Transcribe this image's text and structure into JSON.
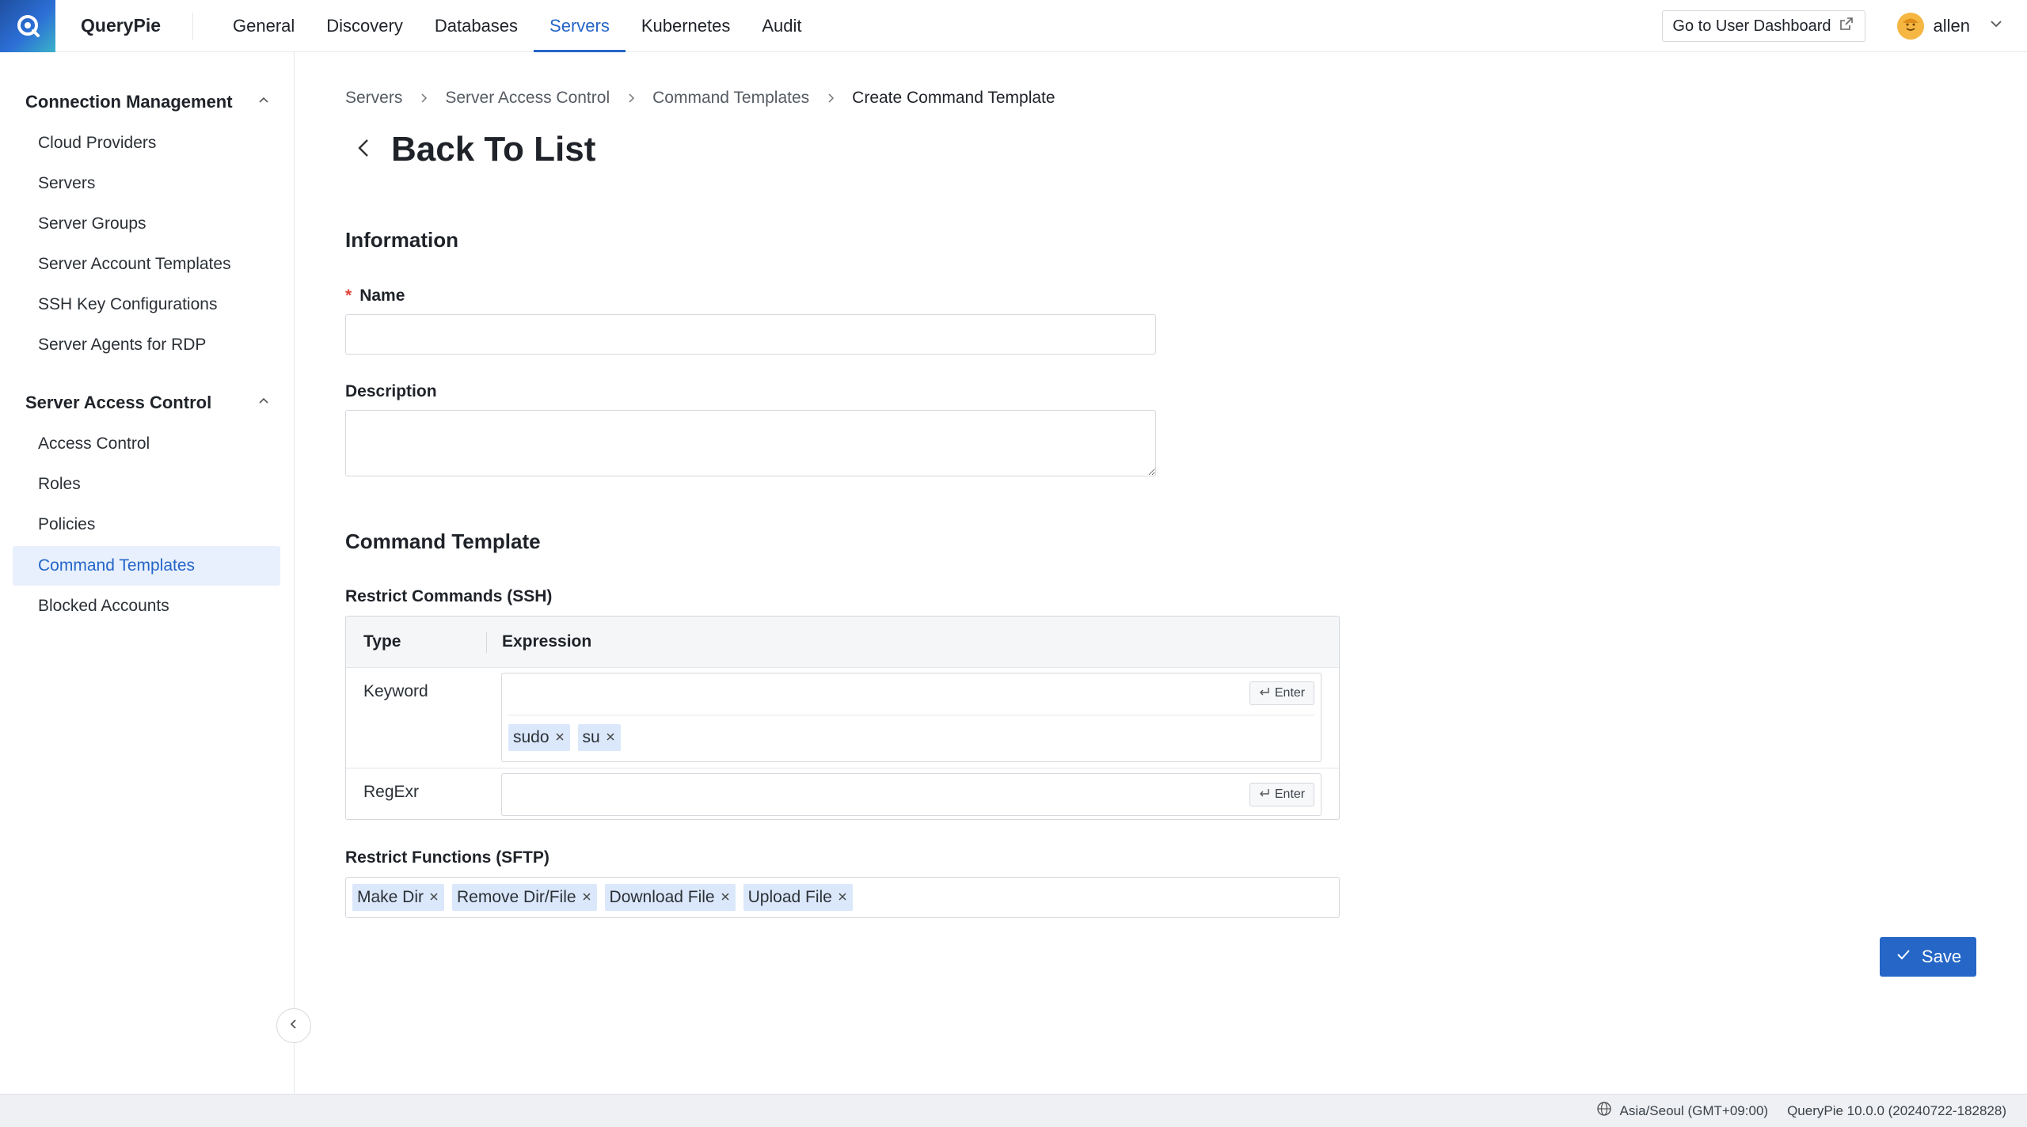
{
  "brand": "QueryPie",
  "nav": {
    "items": [
      "General",
      "Discovery",
      "Databases",
      "Servers",
      "Kubernetes",
      "Audit"
    ],
    "active": "Servers"
  },
  "header": {
    "dashboard_button": "Go to User Dashboard",
    "user_name": "allen"
  },
  "sidebar": {
    "sections": [
      {
        "title": "Connection Management",
        "items": [
          "Cloud Providers",
          "Servers",
          "Server Groups",
          "Server Account Templates",
          "SSH Key Configurations",
          "Server Agents for RDP"
        ]
      },
      {
        "title": "Server Access Control",
        "items": [
          "Access Control",
          "Roles",
          "Policies",
          "Command Templates",
          "Blocked Accounts"
        ]
      }
    ],
    "active_item": "Command Templates"
  },
  "breadcrumb": [
    "Servers",
    "Server Access Control",
    "Command Templates",
    "Create Command Template"
  ],
  "page_title": "Back To List",
  "information": {
    "title": "Information",
    "name_label": "Name",
    "name_required_mark": "*",
    "name_value": "",
    "description_label": "Description",
    "description_value": ""
  },
  "command_template": {
    "title": "Command Template",
    "restrict_ssh_label": "Restrict Commands (SSH)",
    "table": {
      "headers": [
        "Type",
        "Expression"
      ],
      "rows": [
        {
          "type": "Keyword",
          "tags": [
            "sudo",
            "su"
          ]
        },
        {
          "type": "RegExr",
          "tags": []
        }
      ]
    },
    "enter_label": "Enter",
    "restrict_sftp_label": "Restrict Functions (SFTP)",
    "sftp_tags": [
      "Make Dir",
      "Remove Dir/File",
      "Download File",
      "Upload File"
    ]
  },
  "save_label": "Save",
  "footer": {
    "timezone": "Asia/Seoul (GMT+09:00)",
    "version": "QueryPie 10.0.0 (20240722-182828)"
  },
  "colors": {
    "accent": "#2566c7",
    "active_bg": "#e8f0fd",
    "tag_bg": "#dbe8fb",
    "required": "#e0463c"
  },
  "icons": [
    "querypie-logo-icon",
    "external-link-icon",
    "avatar-icon",
    "chevron-down-icon",
    "chevron-up-icon",
    "chevron-right-icon",
    "arrow-left-icon",
    "enter-key-icon",
    "close-icon",
    "check-icon",
    "globe-icon",
    "chevron-left-icon"
  ]
}
